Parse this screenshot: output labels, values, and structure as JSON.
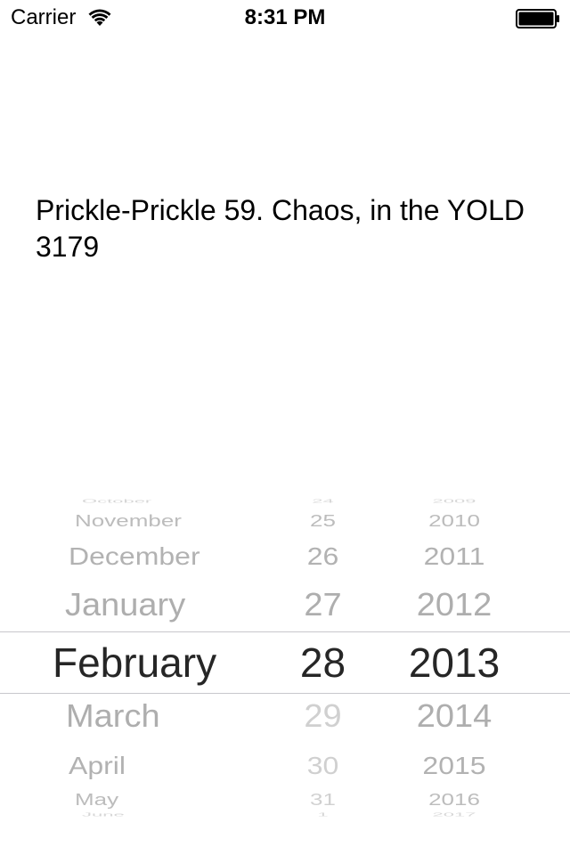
{
  "status_bar": {
    "carrier": "Carrier",
    "time": "8:31 PM",
    "wifi_icon": "wifi-icon",
    "battery_icon": "battery-full-icon"
  },
  "main": {
    "discordian_date": "Prickle-Prickle 59. Chaos, in the YOLD 3179"
  },
  "date_picker": {
    "months": [
      "October",
      "November",
      "December",
      "January",
      "February",
      "March",
      "April",
      "May",
      "June"
    ],
    "days": [
      "24",
      "25",
      "26",
      "27",
      "28",
      "29",
      "30",
      "31",
      "1"
    ],
    "years": [
      "2009",
      "2010",
      "2011",
      "2012",
      "2013",
      "2014",
      "2015",
      "2016",
      "2017"
    ],
    "selected": {
      "month": "February",
      "day": "28",
      "year": "2013"
    }
  }
}
